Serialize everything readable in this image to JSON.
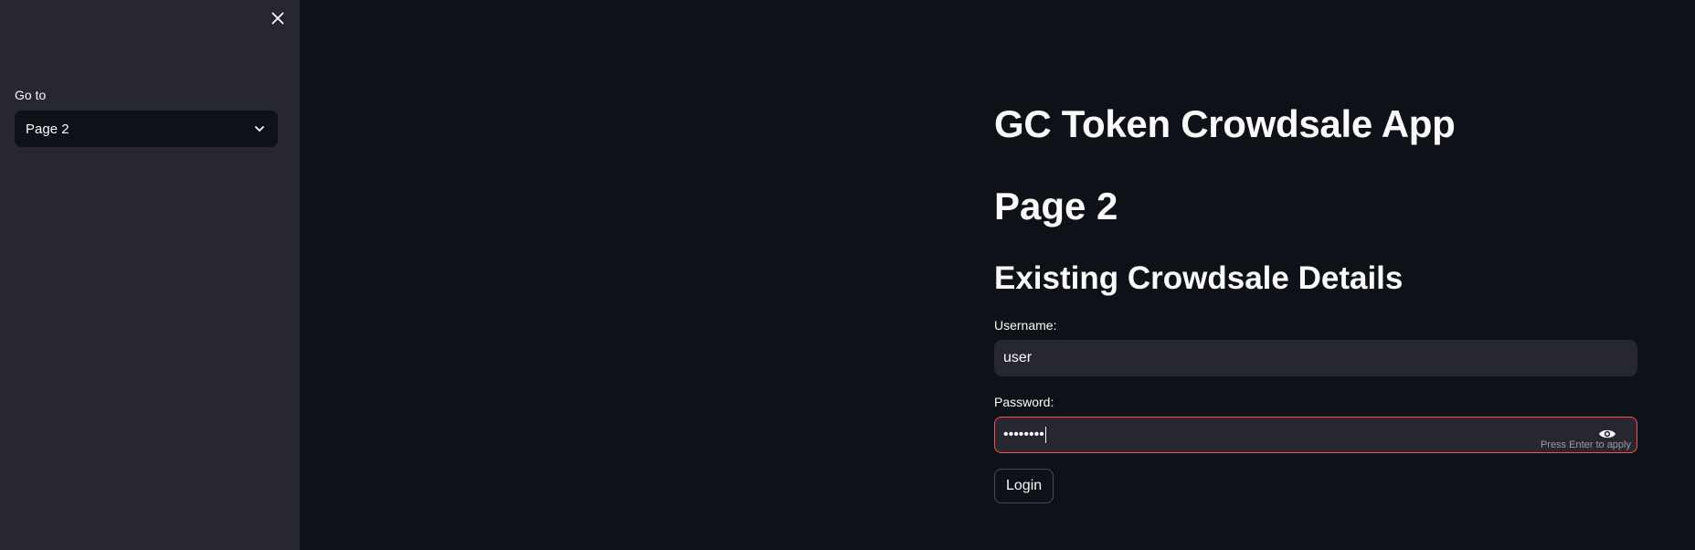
{
  "sidebar": {
    "close_icon": "close-icon",
    "nav_label": "Go to",
    "nav_selected": "Page 2",
    "nav_dropdown_icon": "chevron-down-icon"
  },
  "main": {
    "app_title": "GC Token Crowdsale App",
    "page_title": "Page 2",
    "section_title": "Existing Crowdsale Details",
    "username": {
      "label": "Username:",
      "value": "user"
    },
    "password": {
      "label": "Password:",
      "value": "••••••••",
      "toggle_icon": "eye-icon",
      "hint": "Press Enter to apply"
    },
    "login_label": "Login"
  },
  "colors": {
    "background": "#0e1117",
    "sidebar": "#262730",
    "input": "#262730",
    "error_border": "#ff4b4b",
    "text": "#fafafa"
  }
}
